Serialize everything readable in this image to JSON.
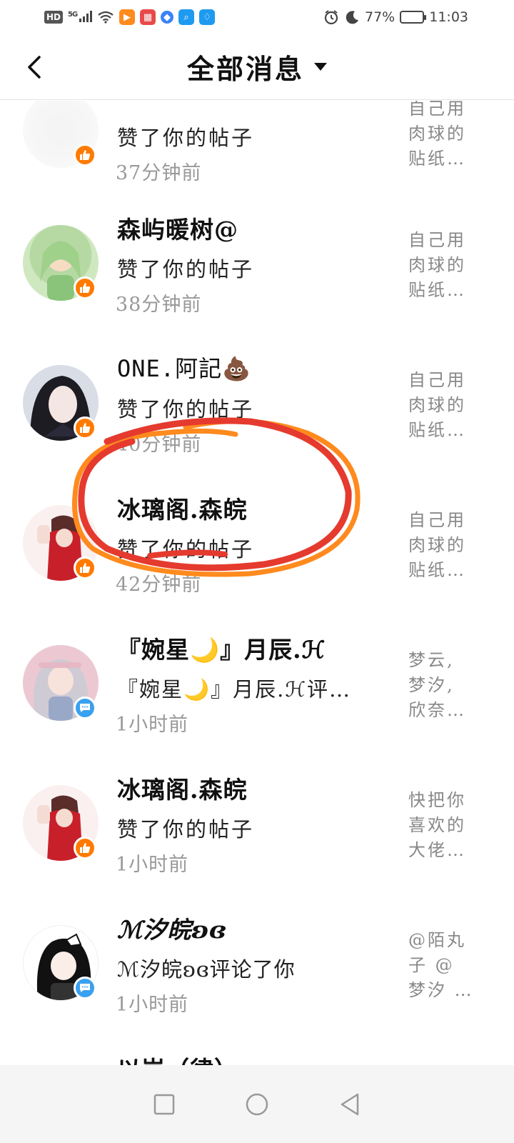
{
  "status_bar": {
    "hd": "HD",
    "signal": "5G",
    "battery_percent": "77%",
    "battery_level": 0.77,
    "time": "11:03"
  },
  "header": {
    "title": "全部消息"
  },
  "messages": [
    {
      "name": "",
      "action": "赞了你的帖子",
      "time": "37分钟前",
      "preview": "自己用\n肉球的\n贴纸…",
      "badge": "like"
    },
    {
      "name": "森屿暖树@",
      "action": "赞了你的帖子",
      "time": "38分钟前",
      "preview": "自己用\n肉球的\n贴纸…",
      "badge": "like"
    },
    {
      "name": "ONE.阿記💩",
      "action": "赞了你的帖子",
      "time": "40分钟前",
      "preview": "自己用\n肉球的\n贴纸…",
      "badge": "like"
    },
    {
      "name": "冰璃阁.森皖",
      "action": "赞了你的帖子",
      "time": "42分钟前",
      "preview": "自己用\n肉球的\n贴纸…",
      "badge": "like"
    },
    {
      "name": "『婉星🌙』月辰.ℋ",
      "action": "『婉星🌙』月辰.ℋ评…",
      "time": "1小时前",
      "preview": "梦云,\n梦汐,\n欣奈…",
      "badge": "comment"
    },
    {
      "name": "冰璃阁.森皖",
      "action": "赞了你的帖子",
      "time": "1小时前",
      "preview": "快把你\n喜欢的\n大佬…",
      "badge": "like"
    },
    {
      "name": "ℳ汐皖ʚɞ",
      "action": "ℳ汐皖ʚɞ评论了你",
      "time": "1小时前",
      "preview": "@陌丸\n子 @\n梦汐 …",
      "badge": "comment"
    },
    {
      "name": "以岚（律᠍᠎）",
      "action": "",
      "time": "",
      "preview": "",
      "badge": ""
    }
  ],
  "colors": {
    "like_badge": "#ff7a00",
    "comment_badge": "#3aa0f0",
    "annotation_red": "#e53a2e",
    "annotation_orange": "#ff8a1e"
  }
}
